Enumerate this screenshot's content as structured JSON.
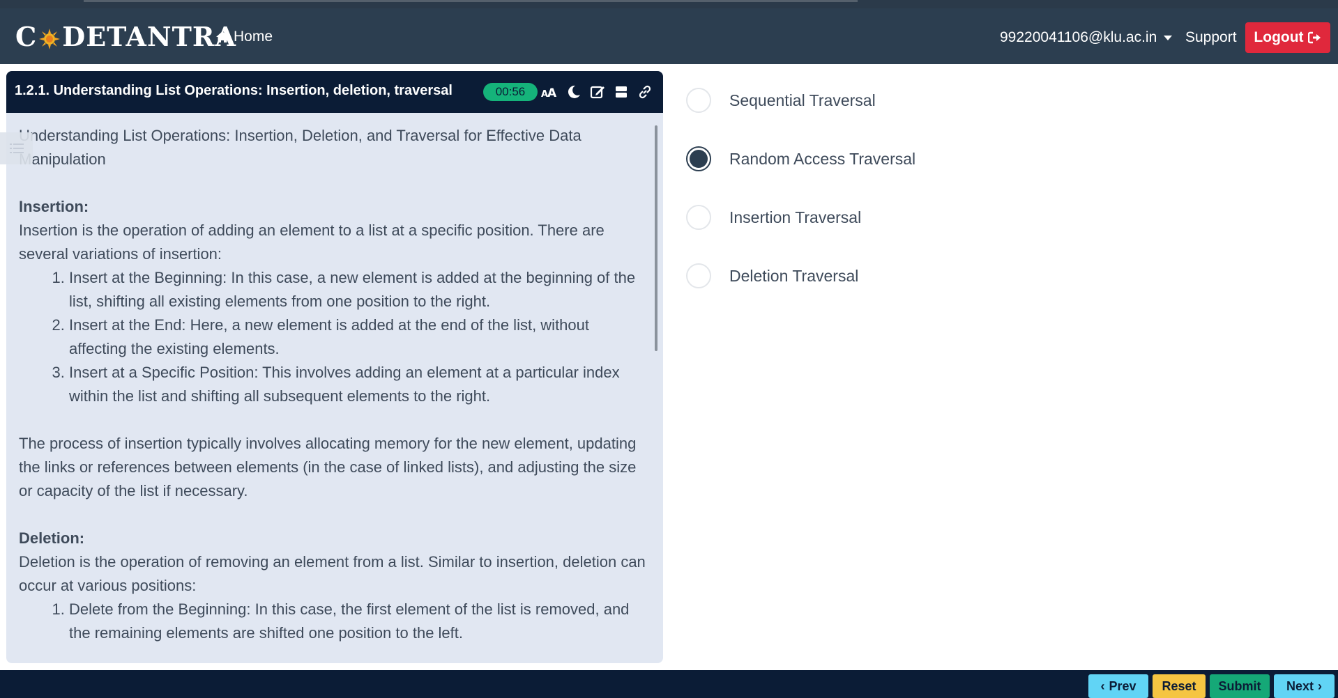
{
  "header": {
    "logo_text_left": "C",
    "logo_text_right": "DETANTRA",
    "home_label": "Home",
    "user_email": "99220041106@klu.ac.in",
    "support_label": "Support",
    "logout_label": "Logout"
  },
  "panel": {
    "title": "1.2.1. Understanding List Operations: Insertion, deletion, traversal",
    "timer": "00:56",
    "intro": "Understanding List Operations: Insertion, Deletion, and Traversal for Effective Data Manipulation",
    "insertion_heading": "Insertion:",
    "insertion_text": "Insertion is the operation of adding an element to a list at a specific position. There are several variations of insertion:",
    "insertion_items": [
      "Insert at the Beginning: In this case, a new element is added at the beginning of the list, shifting all existing elements from one position to the right.",
      "Insert at the End: Here, a new element is added at the end of the list, without affecting the existing elements.",
      "Insert at a Specific Position: This involves adding an element at a particular index within the list and shifting all subsequent elements to the right."
    ],
    "insertion_process": "The process of insertion typically involves allocating memory for the new element, updating the links or references between elements (in the case of linked lists), and adjusting the size or capacity of the list if necessary.",
    "deletion_heading": "Deletion:",
    "deletion_text": "Deletion is the operation of removing an element from a list. Similar to insertion, deletion can occur at various positions:",
    "deletion_items": [
      "Delete from the Beginning: In this case, the first element of the list is removed, and the remaining elements are shifted one position to the left."
    ]
  },
  "options": [
    {
      "label": "Sequential Traversal",
      "selected": false
    },
    {
      "label": "Random Access Traversal",
      "selected": true
    },
    {
      "label": "Insertion Traversal",
      "selected": false
    },
    {
      "label": "Deletion Traversal",
      "selected": false
    }
  ],
  "footer": {
    "prev_label": "Prev",
    "reset_label": "Reset",
    "submit_label": "Submit",
    "next_label": "Next"
  },
  "colors": {
    "header_bg": "#2c3e50",
    "panel_head_bg": "#0b1c36",
    "panel_bg": "#e1e7f2",
    "logout": "#e0283c",
    "timer": "#15b37a",
    "prev_next": "#61d4f5",
    "reset": "#f5c542",
    "submit": "#15a877"
  }
}
